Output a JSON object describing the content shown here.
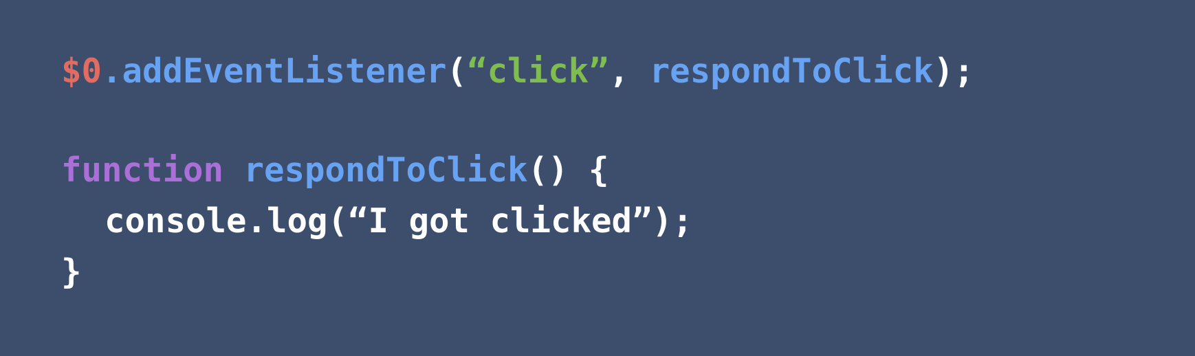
{
  "colors": {
    "background": "#3d4d6c",
    "variable": "#e06c62",
    "method": "#67a3f2",
    "string": "#7fbe4e",
    "keyword": "#ab6fd8",
    "plain": "#ffffff"
  },
  "code": {
    "line1": {
      "var": "$0",
      "dot": ".",
      "method": "addEventListener",
      "open_paren": "(",
      "string": "“click”",
      "comma": ", ",
      "handler": "respondToClick",
      "close": ");"
    },
    "line2": {
      "keyword": "function",
      "space": " ",
      "name": "respondToClick",
      "rest": "() {"
    },
    "line3": {
      "text": "console.log(“I got clicked”);"
    },
    "line4": {
      "text": "}"
    }
  }
}
